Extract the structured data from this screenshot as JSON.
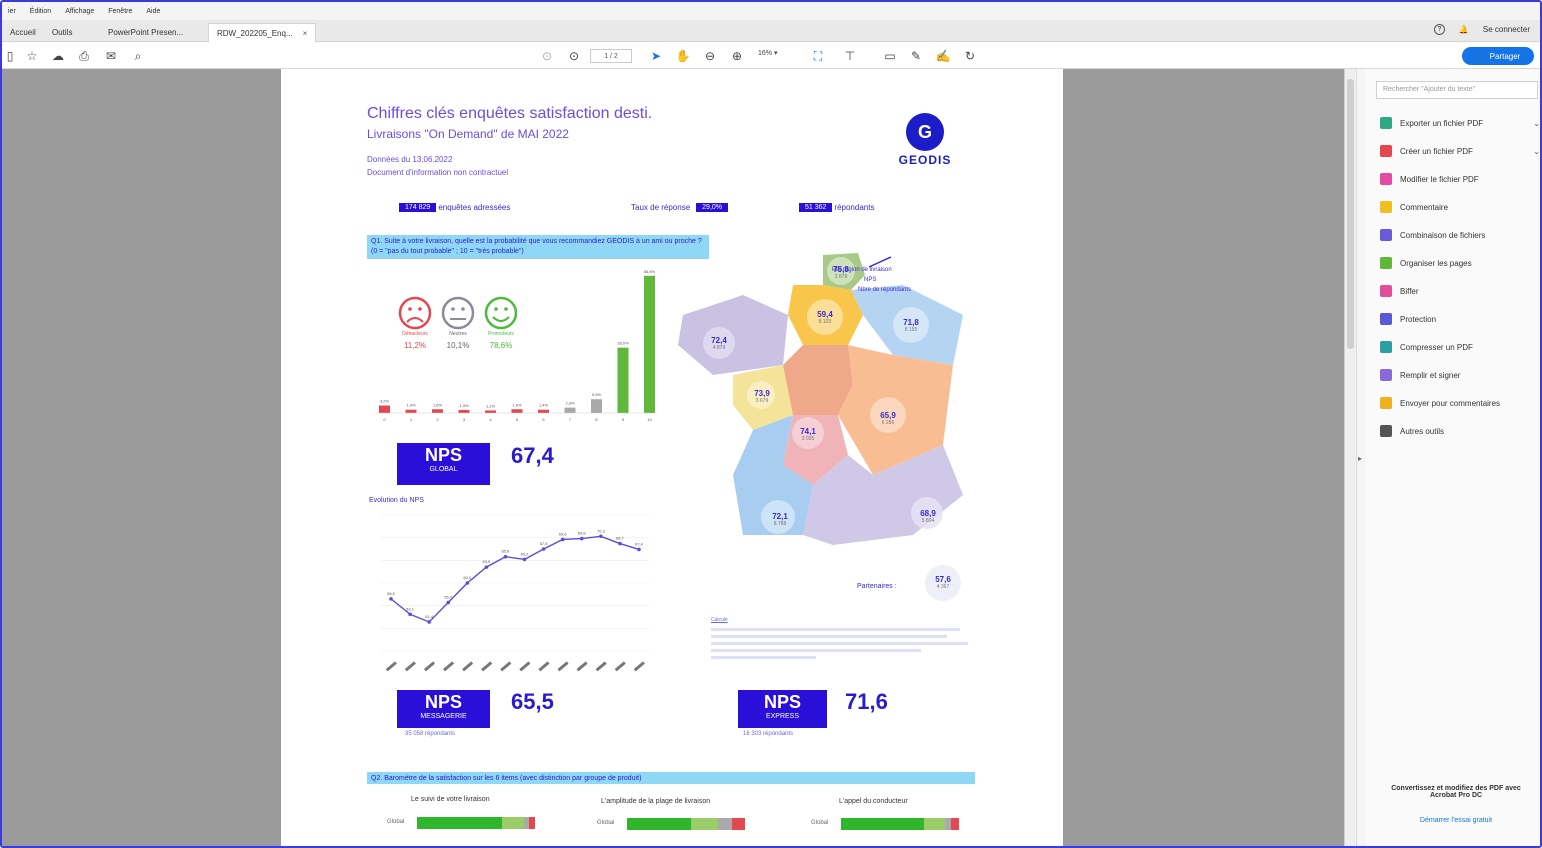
{
  "menubar": {
    "items": [
      "ier",
      "Édition",
      "Affichage",
      "Fenêtre",
      "Aide"
    ]
  },
  "tabs": {
    "home": "Accueil",
    "tools": "Outils",
    "doc1": "PowerPoint Presen...",
    "doc2": "RDW_202205_Enq...",
    "close": "×"
  },
  "header": {
    "help": "?",
    "bell": "🔔",
    "signin": "Se connecter",
    "share": "Partager"
  },
  "toolbar": {
    "page": "1 / 2",
    "zoom": "16% ▾"
  },
  "document": {
    "title": "Chiffres clés enquêtes satisfaction desti.",
    "subtitle": "Livraisons \"On Demand\" de MAI 2022",
    "date": "Données du 13.06.2022",
    "disclaimer": "Document d'information non contractuel",
    "logo_text": "GEODIS",
    "stat1_val": "174 829",
    "stat1_label": "enquêtes adressées",
    "stat2_label": "Taux de réponse",
    "stat2_val": "29,0%",
    "stat3_val": "51 362",
    "stat3_label": "répondants",
    "q1": "Q1. Suite à votre livraison, quelle est la probabilité que vous recommandiez GEODIS à un ami ou proche ? (0 = \"pas du tout probable\" ; 10 = \"très probable\")",
    "detractors": "Détracteurs",
    "detractors_pct": "11,2%",
    "passives": "Neutres",
    "passives_pct": "10,1%",
    "promoters": "Promoteurs",
    "promoters_pct": "78,6%",
    "nps_label": "NPS",
    "global_label": "GLOBAL",
    "global_value": "67,4",
    "evolution_title": "Evolution du NPS",
    "messagerie_label": "MESSAGERIE",
    "messagerie_value": "65,5",
    "messagerie_resp": "35 058 répondants",
    "express_label": "EXPRESS",
    "express_value": "71,6",
    "express_resp": "16 303 répondants",
    "map_legend1": "Par région de livraison",
    "map_legend2": "NPS",
    "map_legend3": "Nbre de répondants",
    "regions": [
      {
        "nps": "75,8",
        "n": "3 679"
      },
      {
        "nps": "59,4",
        "n": "8 103"
      },
      {
        "nps": "71,8",
        "n": "8 155"
      },
      {
        "nps": "72,4",
        "n": "4 879"
      },
      {
        "nps": "73,9",
        "n": "3 679"
      },
      {
        "nps": "74,1",
        "n": "3 035"
      },
      {
        "nps": "65,9",
        "n": "6 286"
      },
      {
        "nps": "72,1",
        "n": "8 788"
      },
      {
        "nps": "68,9",
        "n": "5 804"
      }
    ],
    "partners_label": "Partenaires :",
    "partners_nps": "57,6",
    "partners_n": "4 367",
    "footnote_title": "Calcule",
    "q2": "Q2. Baromètre de la satisfaction sur les 6 items (avec distinction par groupe de produit)",
    "barometre": [
      "Le suivi de votre livraison",
      "L'amplitude de la plage de livraison",
      "L'appel du conducteur"
    ],
    "global_row": "Global"
  },
  "sidebar": {
    "search_placeholder": "Rechercher \"Ajouter du texte\"",
    "tools": [
      {
        "label": "Exporter un fichier PDF",
        "color": "#2fa884"
      },
      {
        "label": "Créer un fichier PDF",
        "color": "#e34850"
      },
      {
        "label": "Modifier le fichier PDF",
        "color": "#e34aa4"
      },
      {
        "label": "Commentaire",
        "color": "#f0c020"
      },
      {
        "label": "Combinaison de fichiers",
        "color": "#6a5ad8"
      },
      {
        "label": "Organiser les pages",
        "color": "#5fb83a"
      },
      {
        "label": "Biffer",
        "color": "#e0509a"
      },
      {
        "label": "Protection",
        "color": "#5a5ad8"
      },
      {
        "label": "Compresser un PDF",
        "color": "#2aa0a0"
      },
      {
        "label": "Remplir et signer",
        "color": "#8a6ad8"
      },
      {
        "label": "Envoyer pour commentaires",
        "color": "#f0b020"
      },
      {
        "label": "Autres outils",
        "color": "#555555"
      }
    ],
    "promo": "Convertissez et modifiez des PDF avec Acrobat Pro DC",
    "trial": "Démarrer l'essai gratuit"
  },
  "colors": {
    "accent": "#2a0fd8",
    "banner": "#8fd8f5",
    "share": "#1473e6"
  },
  "chart_data": [
    {
      "type": "bar",
      "categories": [
        "0",
        "1",
        "2",
        "3",
        "4",
        "5",
        "6",
        "7",
        "8",
        "9",
        "10"
      ],
      "values": [
        3.2,
        1.4,
        1.6,
        1.3,
        1.1,
        1.6,
        1.4,
        2.3,
        5.9,
        28.0,
        58.8
      ],
      "ylim": [
        0,
        60
      ]
    },
    {
      "type": "line",
      "title": "Evolution du NPS",
      "values": [
        56.5,
        53.1,
        51.4,
        55.7,
        60.0,
        63.5,
        65.8,
        65.2,
        67.5,
        69.6,
        69.8,
        70.3,
        68.7,
        67.4
      ],
      "ylim": [
        45,
        75
      ]
    }
  ]
}
